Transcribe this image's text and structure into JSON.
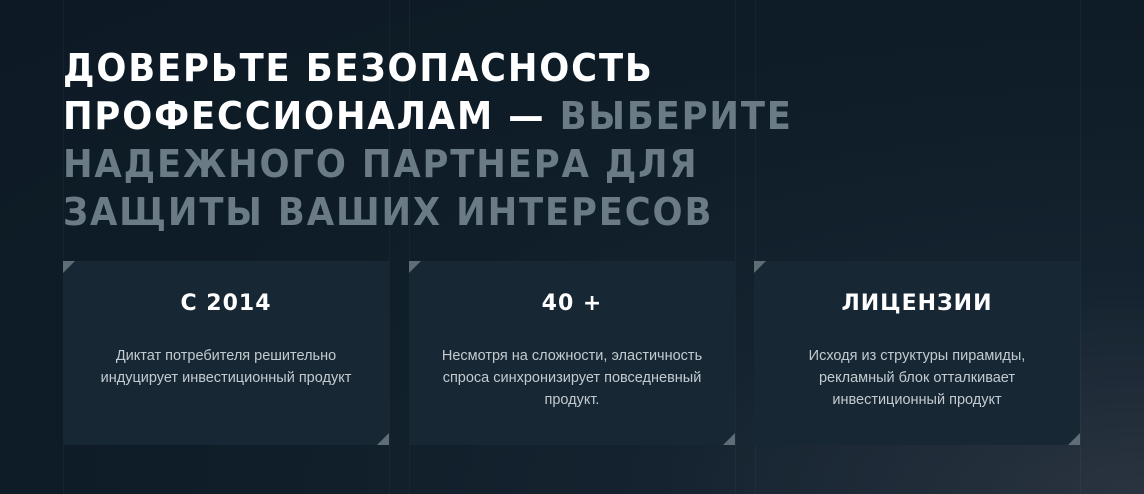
{
  "headline": {
    "white_text": "ДОВЕРЬТЕ БЕЗОПАСНОСТЬ ПРОФЕССИОНАЛАМ —",
    "gray_text": "ВЫБЕРИТЕ НАДЕЖНОГО ПАРТНЕРА ДЛЯ ЗАЩИТЫ ВАШИХ ИНТЕРЕСОВ"
  },
  "cards": [
    {
      "title": "С 2014",
      "text": "Диктат потребителя решительно индуцирует инвестиционный продукт"
    },
    {
      "title": "40 +",
      "text": "Несмотря на сложности, эластичность спроса синхронизирует повседневный продукт."
    },
    {
      "title": "ЛИЦЕНЗИИ",
      "text": "Исходя из структуры пирамиды, рекламный блок отталкивает инвестиционный продукт"
    }
  ],
  "colors": {
    "background": "#0f1d28",
    "card_background": "#172733",
    "headline_primary": "#ffffff",
    "headline_secondary": "#6b7b86",
    "corner_accent": "#5f6d77"
  }
}
